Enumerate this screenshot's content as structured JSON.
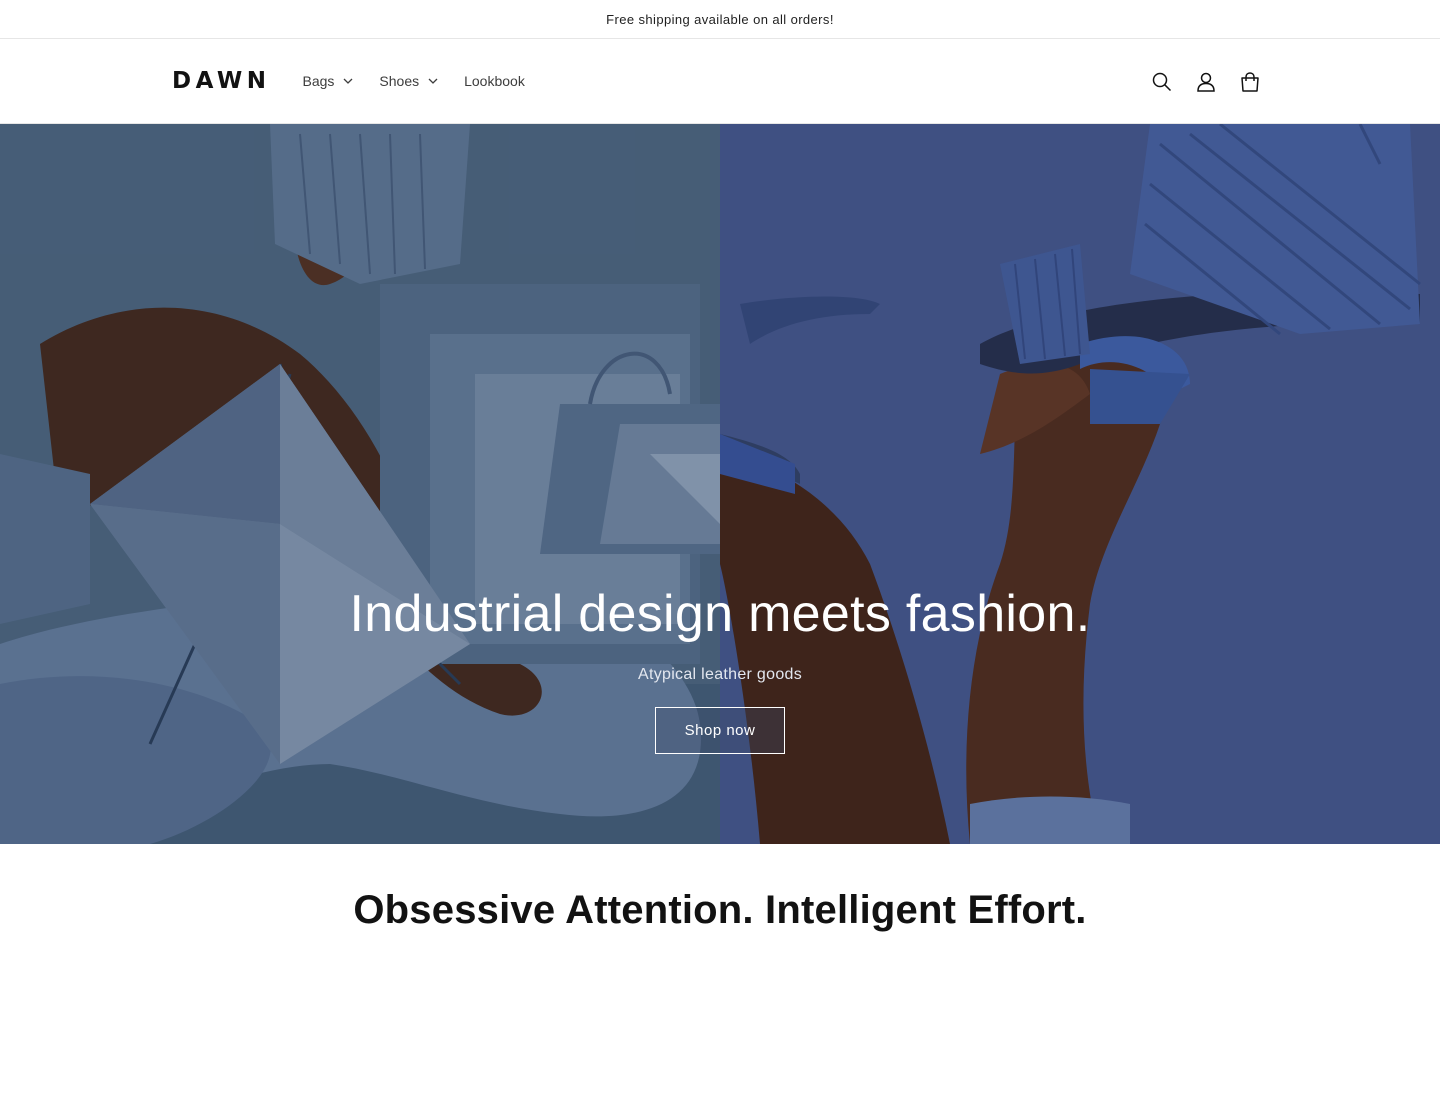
{
  "announcement": {
    "text": "Free shipping available on all orders!"
  },
  "header": {
    "logo": "DAWN",
    "nav": [
      {
        "label": "Bags",
        "has_dropdown": true
      },
      {
        "label": "Shoes",
        "has_dropdown": true
      },
      {
        "label": "Lookbook",
        "has_dropdown": false
      }
    ],
    "icons": [
      "search-icon",
      "account-icon",
      "cart-icon"
    ]
  },
  "hero": {
    "title": "Industrial design meets fashion.",
    "subtitle": "Atypical leather goods",
    "button_label": "Shop now",
    "colors": {
      "left_bg": "#4e6a86",
      "right_bg": "#4b5e8c",
      "accent_blue": "#3f5fa8",
      "skin": "#5a3524",
      "denim": "#6c85a8"
    }
  },
  "section": {
    "heading": "Obsessive Attention. Intelligent Effort."
  }
}
